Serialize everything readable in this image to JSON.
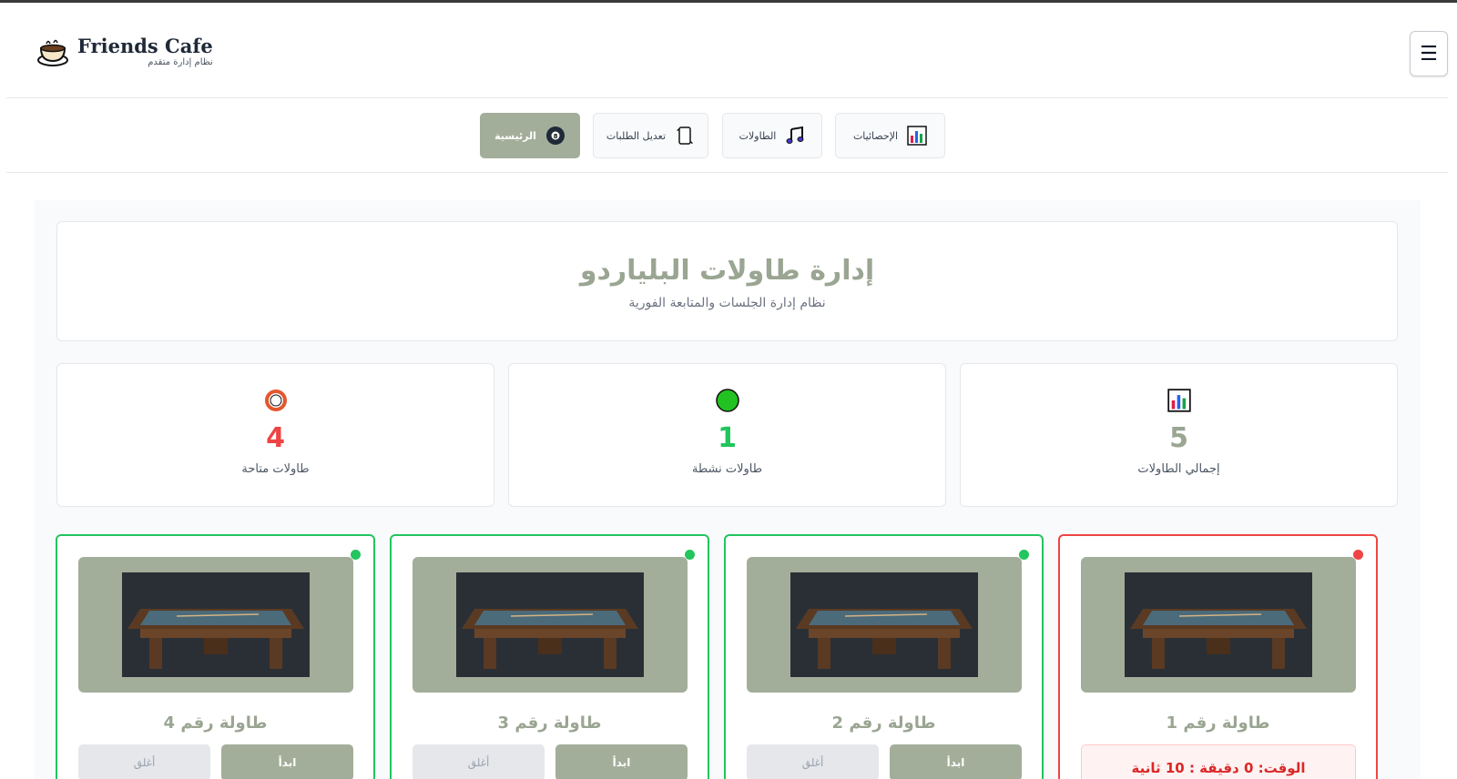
{
  "brand": {
    "title": "Friends Cafe",
    "subtitle": "نظام إدارة متقدم"
  },
  "header": {
    "menu_icon": "hamburger-icon",
    "menu_glyph": "☰"
  },
  "nav": {
    "items": [
      {
        "label": "الإحصائيات",
        "icon": "bar-chart-icon"
      },
      {
        "label": "الطاولات",
        "icon": "music-notes-icon"
      },
      {
        "label": "تعديل الطلبات",
        "icon": "scroll-icon"
      },
      {
        "label": "الرئيسية",
        "icon": "eight-ball-icon",
        "active": true
      }
    ]
  },
  "hero": {
    "title": "إدارة طاولات البلياردو",
    "subtitle": "نظام إدارة الجلسات والمتابعة الفورية"
  },
  "stats": [
    {
      "value": "4",
      "label": "طاولات متاحة",
      "icon": "hollow-red-circle-icon",
      "color": "#ef4444"
    },
    {
      "value": "1",
      "label": "طاولات نشطة",
      "icon": "green-circle-icon",
      "color": "#22c55e"
    },
    {
      "value": "5",
      "label": "إجمالي الطاولات",
      "icon": "bar-chart-icon",
      "color": "#9aa592"
    }
  ],
  "tables": [
    {
      "name": "طاولة رقم 4",
      "status": "available",
      "start_label": "ابدأ",
      "close_label": "أغلق"
    },
    {
      "name": "طاولة رقم 3",
      "status": "available",
      "start_label": "ابدأ",
      "close_label": "أغلق"
    },
    {
      "name": "طاولة رقم 2",
      "status": "available",
      "start_label": "ابدأ",
      "close_label": "أغلق"
    },
    {
      "name": "طاولة رقم 1",
      "status": "active",
      "timer": "الوقت: 0 دقيقة : 10 ثانية"
    }
  ],
  "colors": {
    "accent": "#a3ae9a",
    "accent_text": "#9aa592",
    "available": "#22c55e",
    "active": "#ef4444"
  }
}
